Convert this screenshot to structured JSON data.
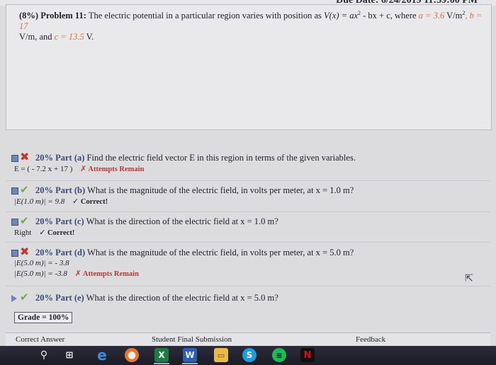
{
  "top": {
    "due_date_fragment": "Due Date: 6/24/2019 11:59:00 PM"
  },
  "problem": {
    "header": "(8%) Problem 11:",
    "text_1": "The electric potential in a particular region varies with position as",
    "formula": "V(x) = ax",
    "formula_exp": "2",
    "formula_rest": " - bx + c, where",
    "a_label": "a =",
    "a_value": "3.6",
    "a_unit": "V/m",
    "a_unit_exp": "2",
    "b_label": ", b =",
    "b_value": "17",
    "line2_unit": "V/m, and",
    "c_label": "c =",
    "c_value": "13.5",
    "c_unit": "V."
  },
  "parts": [
    {
      "status": "wrong",
      "percent": "20% Part (a)",
      "question": "Find the electric field vector E in this region in terms of the given variables.",
      "answers": [
        {
          "value": "E = ( - 7.2 x + 17 )",
          "status_label": "Attempts Remain",
          "status_sym": "✗"
        }
      ]
    },
    {
      "status": "right",
      "percent": "20% Part (b)",
      "question": "What is the magnitude of the electric field, in volts per meter, at x = 1.0 m?",
      "answers": [
        {
          "value": "|E(1.0 m)| = 9.8",
          "status_label": "Correct!",
          "status_sym": "✓"
        }
      ]
    },
    {
      "status": "right",
      "percent": "20% Part (c)",
      "question": "What is the direction of the electric field at x = 1.0 m?",
      "answers": [
        {
          "value": "Right",
          "status_label": "Correct!",
          "status_sym": "✓"
        }
      ]
    },
    {
      "status": "wrong",
      "percent": "20% Part (d)",
      "question": "What is the magnitude of the electric field, in volts per meter, at x = 5.0 m?",
      "answers": [
        {
          "value": "|E(5.0 m)| = - 3.8",
          "status_label": "",
          "status_sym": ""
        },
        {
          "value": "|E(5.0 m)| = -3.8",
          "status_label": "Attempts Remain",
          "status_sym": "✗"
        }
      ]
    },
    {
      "status": "current",
      "percent": "20% Part (e)",
      "question": "What is the direction of the electric field at x = 5.0 m?",
      "answers": []
    }
  ],
  "grade": "Grade = 100%",
  "columns": {
    "correct_answer": "Correct Answer",
    "student_final": "Student Final Submission",
    "feedback": "Feedback"
  },
  "taskbar": {
    "icons": [
      "search-icon",
      "task-view-icon",
      "edge-icon",
      "firefox-icon",
      "excel-icon",
      "word-icon",
      "file-explorer-icon",
      "skype-icon",
      "spotify-icon",
      "netflix-icon"
    ]
  },
  "colors": {
    "param": "#d7713a",
    "correct": "#6aa84f",
    "wrong": "#c0392b",
    "accent": "#3a4a78"
  }
}
